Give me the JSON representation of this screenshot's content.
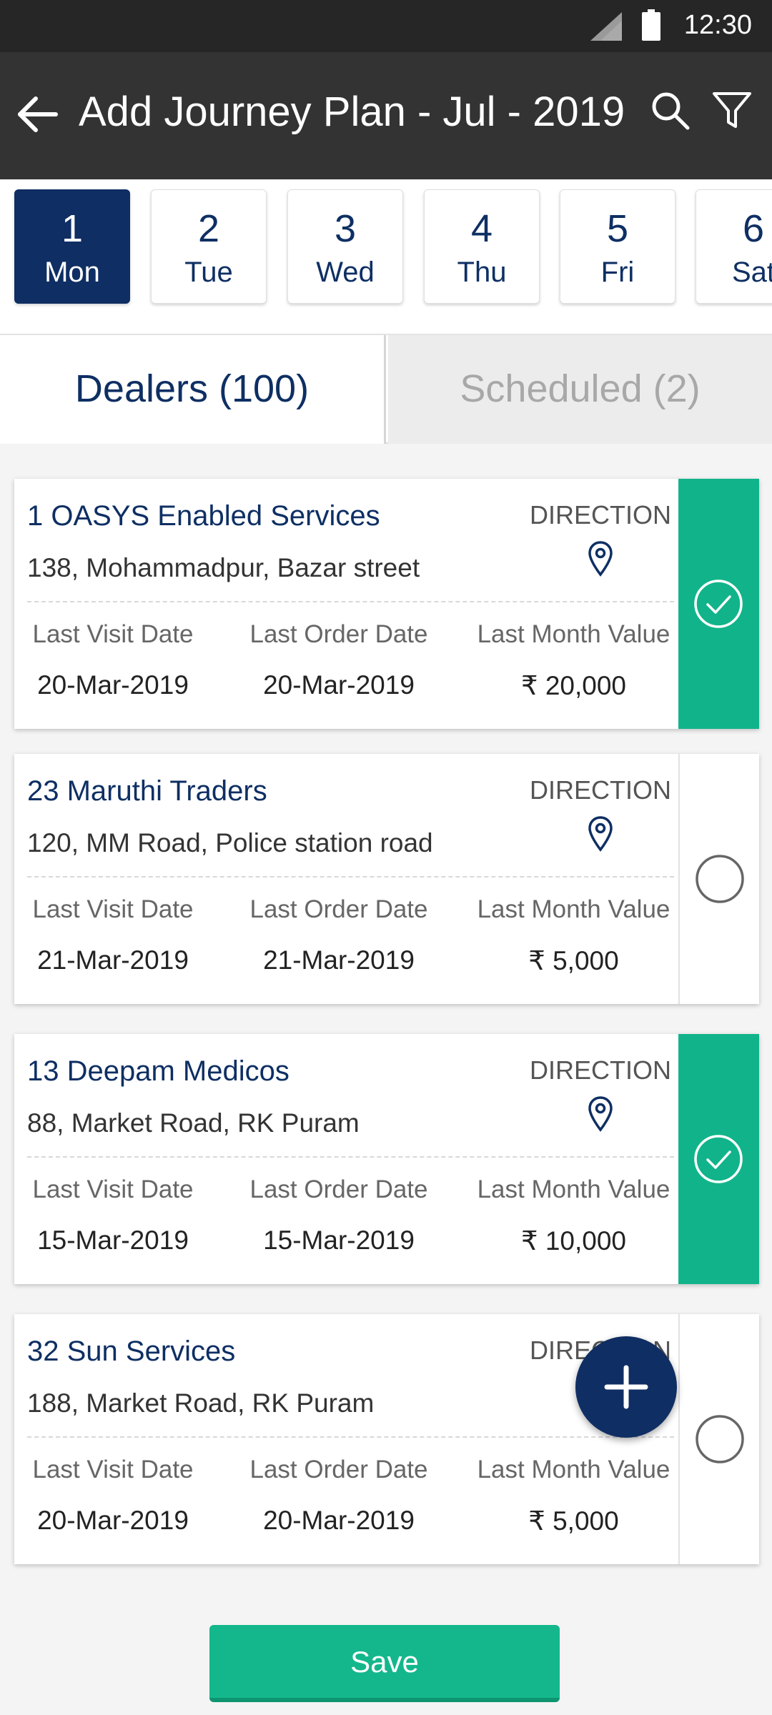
{
  "status_bar": {
    "time": "12:30"
  },
  "header": {
    "title": "Add Journey Plan - Jul - 2019"
  },
  "dates": [
    {
      "num": "1",
      "dow": "Mon",
      "selected": true
    },
    {
      "num": "2",
      "dow": "Tue",
      "selected": false
    },
    {
      "num": "3",
      "dow": "Wed",
      "selected": false
    },
    {
      "num": "4",
      "dow": "Thu",
      "selected": false
    },
    {
      "num": "5",
      "dow": "Fri",
      "selected": false
    },
    {
      "num": "6",
      "dow": "Sat",
      "selected": false
    }
  ],
  "tabs": [
    {
      "label": "Dealers (100)",
      "active": true
    },
    {
      "label": "Scheduled (2)",
      "active": false
    }
  ],
  "labels": {
    "direction": "DIRECTION",
    "last_visit": "Last Visit Date",
    "last_order": "Last Order Date",
    "last_month_value": "Last Month Value"
  },
  "dealers": [
    {
      "name": "1 OASYS Enabled Services",
      "address": "138, Mohammadpur,  Bazar street",
      "last_visit": "20-Mar-2019",
      "last_order": "20-Mar-2019",
      "value": "₹ 20,000",
      "selected": true
    },
    {
      "name": "23 Maruthi Traders",
      "address": "120, MM Road,  Police station road",
      "last_visit": "21-Mar-2019",
      "last_order": "21-Mar-2019",
      "value": "₹ 5,000",
      "selected": false
    },
    {
      "name": "13 Deepam Medicos",
      "address": "88, Market Road,  RK Puram",
      "last_visit": "15-Mar-2019",
      "last_order": "15-Mar-2019",
      "value": "₹ 10,000",
      "selected": true
    },
    {
      "name": "32 Sun Services",
      "address": "188, Market Road,  RK Puram",
      "last_visit": "20-Mar-2019",
      "last_order": "20-Mar-2019",
      "value": "₹ 5,000",
      "selected": false
    }
  ],
  "save_label": "Save",
  "colors": {
    "primary": "#0f2e63",
    "accent_green": "#11b48a",
    "app_bar": "#333333"
  }
}
